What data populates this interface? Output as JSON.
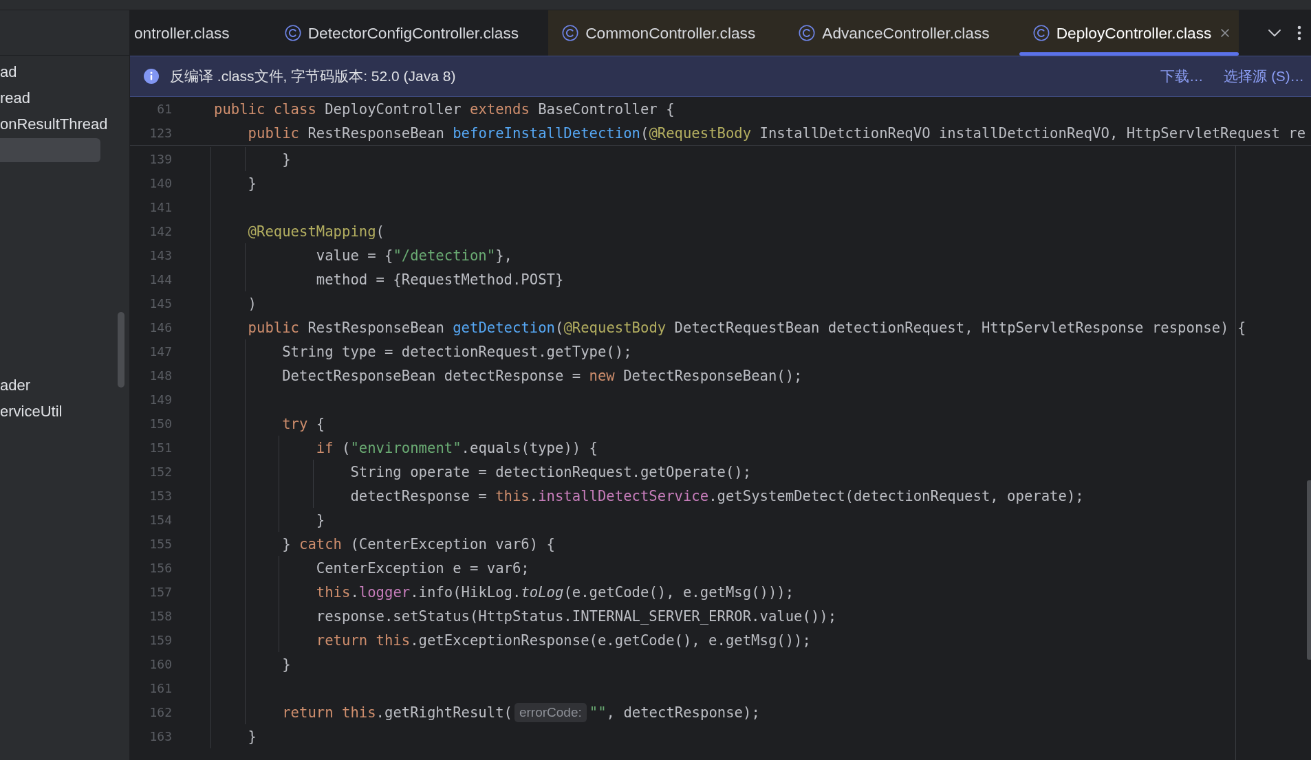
{
  "tabs": [
    {
      "label": "ontroller.class",
      "selected": false,
      "icon_shown": false,
      "color": "#1e1f22"
    },
    {
      "label": "DetectorConfigController.class",
      "selected": false,
      "icon_shown": true,
      "color": "#1e1f22"
    },
    {
      "label": "CommonController.class",
      "selected": false,
      "icon_shown": true,
      "color": "#2e2a22"
    },
    {
      "label": "AdvanceController.class",
      "selected": false,
      "icon_shown": true,
      "color": "#2e2a22"
    },
    {
      "label": "DeployController.class",
      "selected": true,
      "icon_shown": true,
      "color": "#2e2a22"
    }
  ],
  "sidebar": {
    "items": [
      {
        "label": "ad",
        "selected": false
      },
      {
        "label": "read",
        "selected": false
      },
      {
        "label": "onResultThread",
        "selected": false
      },
      {
        "selected": true
      }
    ],
    "lower_items": [
      {
        "label": "ader",
        "selected": false
      },
      {
        "label": "erviceUtil",
        "selected": false
      }
    ]
  },
  "info_bar": {
    "message": "反编译 .class文件, 字节码版本: 52.0 (Java 8)",
    "links": [
      "下载…",
      "选择源 (S)…"
    ]
  },
  "editor": {
    "lines": [
      {
        "number": "61",
        "tokens": [
          {
            "kind": "keyword",
            "text": "public "
          },
          {
            "kind": "keyword",
            "text": "class"
          },
          {
            "kind": "plain",
            "text": " DeployController "
          },
          {
            "kind": "keyword",
            "text": "extends"
          },
          {
            "kind": "plain",
            "text": " BaseController {"
          }
        ],
        "children": [
          {
            "number": "123",
            "tokens": [
              {
                "kind": "keyword",
                "text": "public"
              },
              {
                "kind": "plain",
                "text": " RestResponseBean "
              },
              {
                "kind": "method",
                "text": "beforeInstallDetection"
              },
              {
                "kind": "plain",
                "text": "("
              },
              {
                "kind": "annotation",
                "text": "@RequestBody"
              },
              {
                "kind": "plain",
                "text": " InstallDetctionReqVO installDetctionReqVO, HttpServletRequest re"
              }
            ],
            "children": [
              {
                "number": "139",
                "tokens": [
                  {
                    "kind": "plain",
                    "text": "}"
                  }
                ]
              }
            ]
          },
          {
            "number": "140",
            "tokens": [
              {
                "kind": "plain",
                "text": "}"
              }
            ]
          },
          {
            "number": "141"
          },
          {
            "number": "142",
            "tokens": [
              {
                "kind": "annotation",
                "text": "@RequestMapping"
              },
              {
                "kind": "plain",
                "text": "("
              }
            ],
            "continuation": [
              {
                "number": "143",
                "tokens": [
                  {
                    "kind": "plain",
                    "text": "value = {"
                  },
                  {
                    "kind": "string",
                    "text": "\"/detection\""
                  },
                  {
                    "kind": "plain",
                    "text": "},"
                  }
                ]
              },
              {
                "number": "144",
                "tokens": [
                  {
                    "kind": "plain",
                    "text": "method = {RequestMethod.POST}"
                  }
                ]
              }
            ]
          },
          {
            "number": "145",
            "tokens": [
              {
                "kind": "plain",
                "text": ")"
              }
            ]
          },
          {
            "number": "146",
            "tokens": [
              {
                "kind": "keyword",
                "text": "public"
              },
              {
                "kind": "plain",
                "text": " RestResponseBean "
              },
              {
                "kind": "method",
                "text": "getDetection"
              },
              {
                "kind": "plain",
                "text": "("
              },
              {
                "kind": "annotation",
                "text": "@RequestBody"
              },
              {
                "kind": "plain",
                "text": " DetectRequestBean detectionRequest, HttpServletResponse response) {"
              }
            ],
            "children": [
              {
                "number": "147",
                "tokens": [
                  {
                    "kind": "plain",
                    "text": "String type = detectionRequest.getType();"
                  }
                ]
              },
              {
                "number": "148",
                "tokens": [
                  {
                    "kind": "plain",
                    "text": "DetectResponseBean detectResponse = "
                  },
                  {
                    "kind": "keyword",
                    "text": "new"
                  },
                  {
                    "kind": "plain",
                    "text": " DetectResponseBean();"
                  }
                ]
              },
              {
                "number": "149"
              },
              {
                "number": "150",
                "tokens": [
                  {
                    "kind": "keyword",
                    "text": "try"
                  },
                  {
                    "kind": "plain",
                    "text": " {"
                  }
                ],
                "children": [
                  {
                    "number": "151",
                    "tokens": [
                      {
                        "kind": "keyword",
                        "text": "if"
                      },
                      {
                        "kind": "plain",
                        "text": " ("
                      },
                      {
                        "kind": "string",
                        "text": "\"environment\""
                      },
                      {
                        "kind": "plain",
                        "text": ".equals(type)) {"
                      }
                    ],
                    "children": [
                      {
                        "number": "152",
                        "tokens": [
                          {
                            "kind": "plain",
                            "text": "String operate = detectionRequest.getOperate();"
                          }
                        ]
                      },
                      {
                        "number": "153",
                        "tokens": [
                          {
                            "kind": "plain",
                            "text": "detectResponse = "
                          },
                          {
                            "kind": "keyword",
                            "text": "this"
                          },
                          {
                            "kind": "plain",
                            "text": "."
                          },
                          {
                            "kind": "field",
                            "text": "installDetectService"
                          },
                          {
                            "kind": "plain",
                            "text": ".getSystemDetect(detectionRequest, operate);"
                          }
                        ]
                      }
                    ]
                  },
                  {
                    "number": "154",
                    "tokens": [
                      {
                        "kind": "plain",
                        "text": "}"
                      }
                    ]
                  }
                ]
              },
              {
                "number": "155",
                "tokens": [
                  {
                    "kind": "plain",
                    "text": "} "
                  },
                  {
                    "kind": "keyword",
                    "text": "catch"
                  },
                  {
                    "kind": "plain",
                    "text": " (CenterException var6) {"
                  }
                ],
                "children": [
                  {
                    "number": "156",
                    "tokens": [
                      {
                        "kind": "plain",
                        "text": "CenterException e = var6;"
                      }
                    ]
                  },
                  {
                    "number": "157",
                    "tokens": [
                      {
                        "kind": "keyword",
                        "text": "this"
                      },
                      {
                        "kind": "plain",
                        "text": "."
                      },
                      {
                        "kind": "field",
                        "text": "logger"
                      },
                      {
                        "kind": "plain",
                        "text": ".info(HikLog."
                      },
                      {
                        "kind": "static",
                        "text": "toLog"
                      },
                      {
                        "kind": "plain",
                        "text": "(e.getCode(), e.getMsg()));"
                      }
                    ]
                  },
                  {
                    "number": "158",
                    "tokens": [
                      {
                        "kind": "plain",
                        "text": "response.setStatus(HttpStatus.INTERNAL_SERVER_ERROR.value());"
                      }
                    ]
                  },
                  {
                    "number": "159",
                    "tokens": [
                      {
                        "kind": "keyword",
                        "text": "return this"
                      },
                      {
                        "kind": "plain",
                        "text": ".getExceptionResponse(e.getCode(), e.getMsg());"
                      }
                    ]
                  }
                ]
              },
              {
                "number": "160",
                "tokens": [
                  {
                    "kind": "plain",
                    "text": "}"
                  }
                ]
              },
              {
                "number": "161"
              },
              {
                "number": "162",
                "tokens": [
                  {
                    "kind": "keyword",
                    "text": "return this"
                  },
                  {
                    "kind": "plain",
                    "text": ".getRightResult("
                  },
                  {
                    "kind": "hint",
                    "text": "errorCode:"
                  },
                  {
                    "kind": "string",
                    "text": "\"\""
                  },
                  {
                    "kind": "plain",
                    "text": ", detectResponse);"
                  }
                ]
              }
            ]
          },
          {
            "number": "163",
            "tokens": [
              {
                "kind": "plain",
                "text": "}"
              }
            ]
          }
        ]
      }
    ]
  }
}
